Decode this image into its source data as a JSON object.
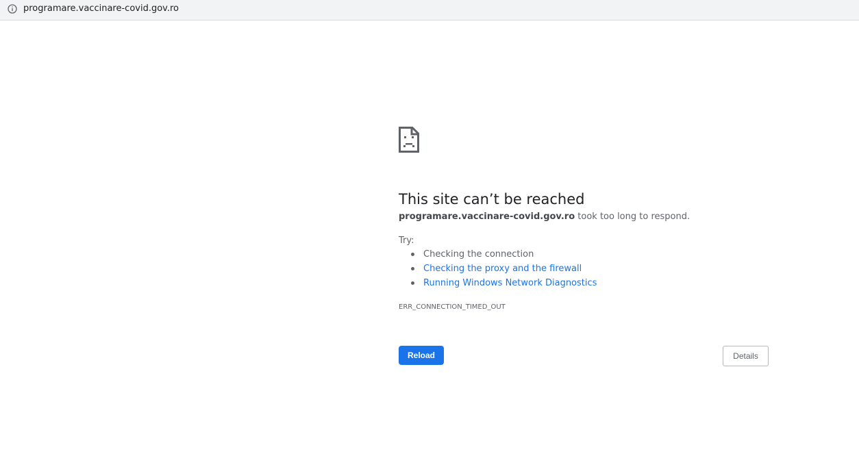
{
  "address_bar": {
    "url": "programare.vaccinare-covid.gov.ro",
    "icon": "info-icon"
  },
  "error_page": {
    "icon": "sad-page-icon",
    "title": "This site can’t be reached",
    "host": "programare.vaccinare-covid.gov.ro",
    "message": " took too long to respond.",
    "try_label": "Try:",
    "suggestions": [
      "Checking the connection",
      "Checking the proxy and the firewall",
      "Running Windows Network Diagnostics"
    ],
    "error_code": "ERR_CONNECTION_TIMED_OUT",
    "reload_label": "Reload",
    "details_label": "Details"
  },
  "colors": {
    "link": "#1a73e8",
    "primary_button": "#1a73e8",
    "text": "#202124",
    "secondary_text": "#5f6368"
  }
}
